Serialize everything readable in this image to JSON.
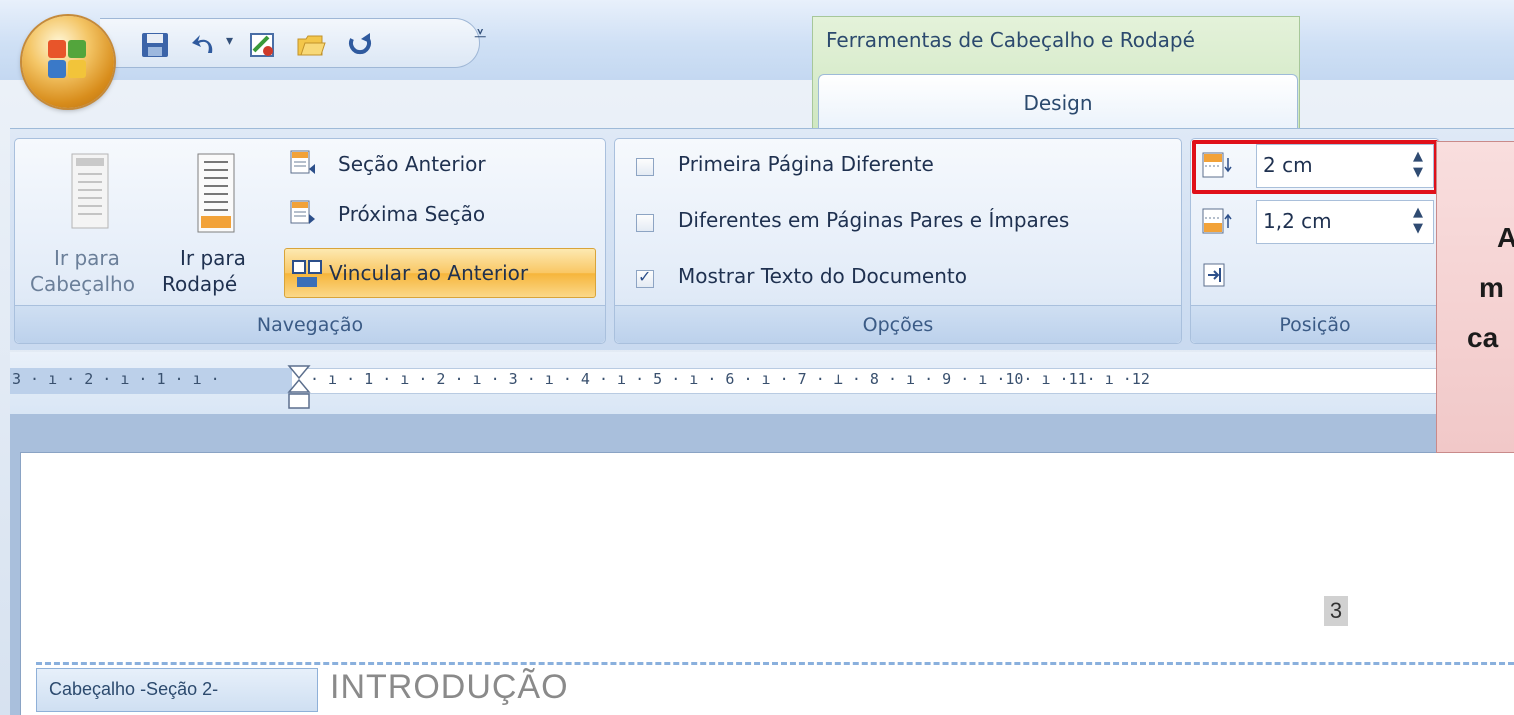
{
  "context_tab": {
    "group_title": "Ferramentas de Cabeçalho e Rodapé",
    "tab_label": "Design"
  },
  "navegacao": {
    "label": "Navegação",
    "ir_cabecalho_line1": "Ir para",
    "ir_cabecalho_line2": "Cabeçalho",
    "ir_rodape_line1": "Ir para",
    "ir_rodape_line2": "Rodapé",
    "secao_anterior": "Seção Anterior",
    "proxima_secao": "Próxima Seção",
    "vincular": "Vincular ao Anterior"
  },
  "opcoes": {
    "label": "Opções",
    "primeira": "Primeira Página Diferente",
    "pares_impares": "Diferentes em Páginas Pares e Ímpares",
    "mostrar_texto": "Mostrar Texto do Documento",
    "primeira_checked": false,
    "pares_impares_checked": false,
    "mostrar_texto_checked": true
  },
  "posicao": {
    "label": "Posição",
    "header_distance": "2 cm",
    "footer_distance": "1,2 cm"
  },
  "ruler": {
    "ticks": "3 · ı · 2 · ı · 1 · ı ·",
    "ticks_right": "· ı · 1 · ı · 2 · ı · 3 · ı · 4 · ı · 5 · ı · 6 · ı · 7 · ⊥ · 8 · ı · 9 · ı ·10· ı ·11· ı ·12"
  },
  "document": {
    "page_number": "3",
    "header_tag": "Cabeçalho -Seção 2-",
    "heading_text": "INTRODUÇÃO"
  },
  "tooltip": {
    "line1": "A",
    "line2": "m",
    "line3": "ca"
  },
  "colors": {
    "highlight": "#e0101a",
    "tooltip_bg": "#f5d4d4",
    "office_orb": "#e9a23b"
  }
}
